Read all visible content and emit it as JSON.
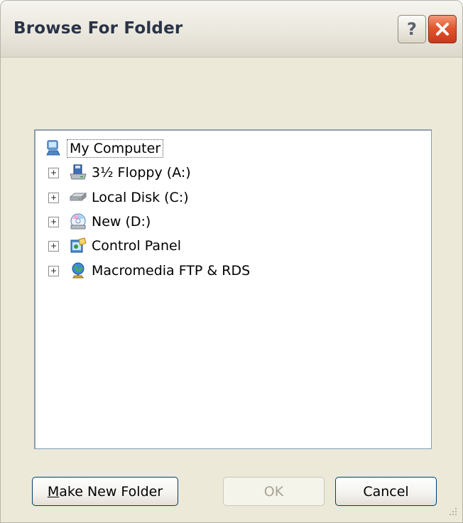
{
  "window": {
    "title": "Browse For Folder",
    "help_label": "?",
    "close_label": "✕"
  },
  "tree": {
    "root": {
      "label": "My Computer",
      "icon": "my-computer-icon",
      "selected_focus": true
    },
    "items": [
      {
        "label": "3½ Floppy (A:)",
        "icon": "floppy-drive-icon",
        "expander": "+"
      },
      {
        "label": "Local Disk (C:)",
        "icon": "hard-disk-icon",
        "expander": "+"
      },
      {
        "label": "New (D:)",
        "icon": "cd-drive-icon",
        "expander": "+"
      },
      {
        "label": "Control Panel",
        "icon": "control-panel-icon",
        "expander": "+"
      },
      {
        "label": "Macromedia FTP & RDS",
        "icon": "network-globe-icon",
        "expander": "+"
      }
    ]
  },
  "buttons": {
    "make_new_folder": "Make New Folder",
    "ok": "OK",
    "cancel": "Cancel"
  },
  "colors": {
    "dialog_bg": "#ece9d8",
    "close_button": "#e2572d",
    "border_accent": "#003c74"
  }
}
